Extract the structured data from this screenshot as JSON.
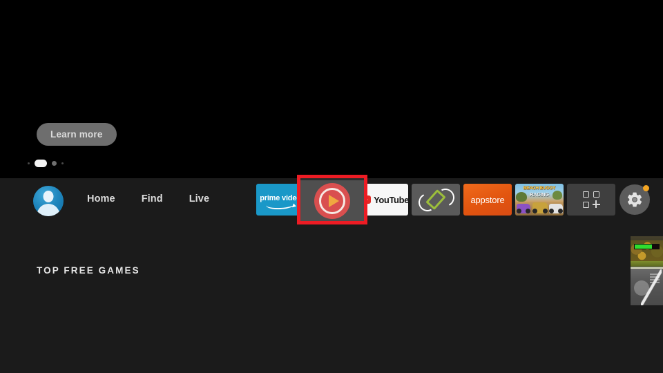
{
  "hero": {
    "learn_more_label": "Learn more",
    "pager": [
      {
        "name": "page-dot-1",
        "state": "tiny"
      },
      {
        "name": "page-dot-2",
        "state": "active"
      },
      {
        "name": "page-dot-3",
        "state": "small"
      },
      {
        "name": "page-dot-4",
        "state": "tiny"
      }
    ],
    "background_color": "#000000"
  },
  "nav": {
    "avatar_icon": "user-avatar-icon",
    "links": [
      {
        "label": "Home"
      },
      {
        "label": "Find"
      },
      {
        "label": "Live"
      }
    ]
  },
  "shelf": {
    "title": "TOP FREE GAMES",
    "background_color": "#1b1b1b"
  },
  "tiles": {
    "prime_video": {
      "label": "prime video",
      "icon": "prime-video-icon",
      "color": "#1a98c8"
    },
    "media_player": {
      "label": "",
      "icon": "play-circle-icon",
      "selected": true,
      "focus_color": "#ed1c24"
    },
    "youtube": {
      "label": "YouTube",
      "icon": "youtube-play-icon",
      "color": "#f7f7f7"
    },
    "screen_rotate": {
      "label": "",
      "icon": "rotate-screen-icon",
      "color": "#5a5a5a"
    },
    "appstore": {
      "label": "appstore",
      "icon": "appstore-icon",
      "color": "#e2550f"
    },
    "racing_game": {
      "title": "BEACH BUGGY",
      "subtitle": "RACING",
      "icon": "racing-game-icon"
    },
    "all_apps": {
      "label": "",
      "icon": "apps-grid-plus-icon",
      "color": "#3f3f3f"
    },
    "settings": {
      "label": "",
      "icon": "gear-icon",
      "badge": true,
      "badge_color": "#f5a623"
    }
  },
  "pip": {
    "name": "picture-in-picture-game",
    "progress_percent": 72,
    "progress_color": "#2fdd2f"
  }
}
